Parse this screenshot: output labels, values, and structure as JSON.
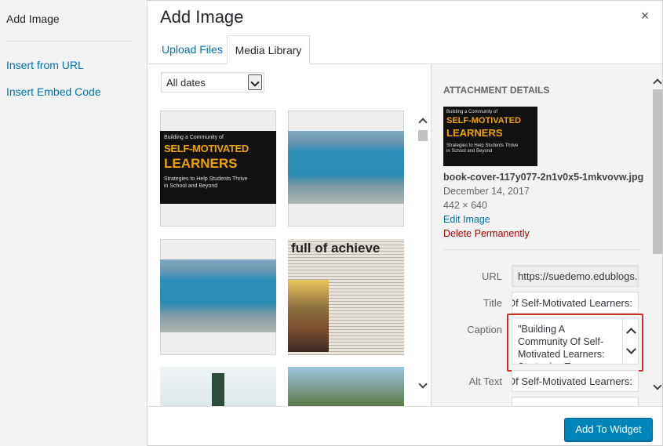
{
  "menu": {
    "title": "Add Image",
    "insert_from_url": "Insert from URL",
    "insert_embed": "Insert Embed Code"
  },
  "header": {
    "title": "Add Image",
    "close_glyph": "×",
    "tabs": [
      {
        "label": "Upload Files",
        "active": false
      },
      {
        "label": "Media Library",
        "active": true
      }
    ]
  },
  "filter": {
    "selected": "All dates"
  },
  "thumbnails": {
    "cover": {
      "line1": "Building a Community of",
      "line2": "SELF-MOTIVATED",
      "line3": "LEARNERS",
      "line4a": "Strategies to Help Students Thrive",
      "line4b": "in School and Beyond"
    },
    "newspaper_headline": "full of achieve"
  },
  "details": {
    "heading": "Attachment Details",
    "filename": "book-cover-117y077-2n1v0x5-1mkvovw.jpg",
    "date": "December 14, 2017",
    "dimensions": "442 × 640",
    "edit_link": "Edit Image",
    "delete_link": "Delete Permanently",
    "fields": {
      "url_label": "URL",
      "url_value": "https://suedemo.edublogs.o",
      "title_label": "Title",
      "title_value": "Building A Community Of Self-Motivated Learners:",
      "caption_label": "Caption",
      "caption_value": "\"Building A Community Of Self-Motivated Learners: Strategies To",
      "alt_label": "Alt Text",
      "alt_value": "Building A Community Of Self-Motivated Learners:"
    }
  },
  "toolbar": {
    "primary_label": "Add To Widget"
  },
  "colors": {
    "link": "#0073aa",
    "delete": "#aa0000",
    "primary": "#0085ba",
    "highlight": "#d32f2f",
    "cover_accent": "#f0a300"
  }
}
